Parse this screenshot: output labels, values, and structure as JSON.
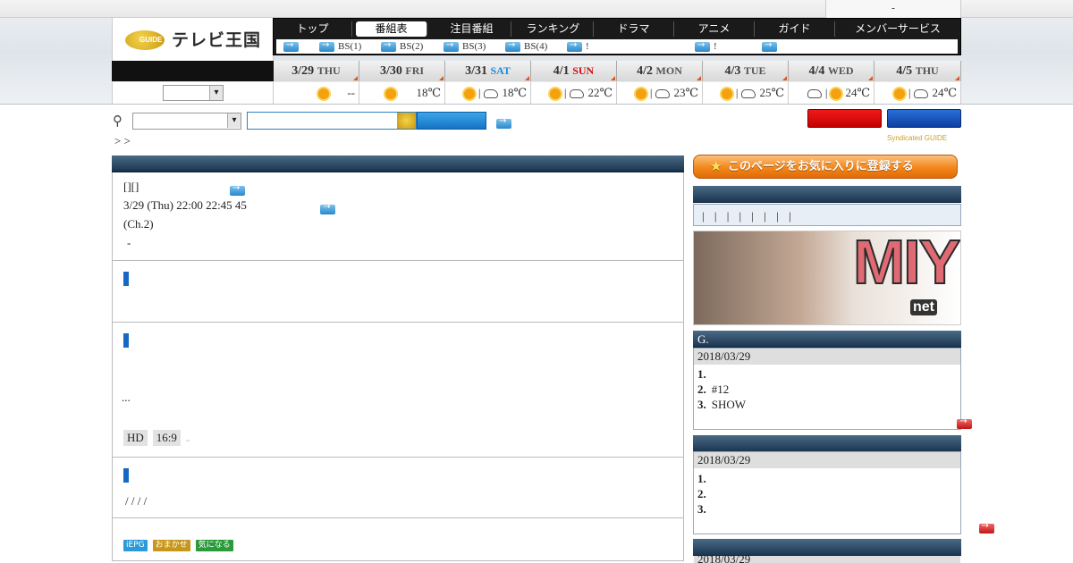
{
  "utility": {
    "text": "-"
  },
  "logo": {
    "badge": "GUIDE",
    "title": "テレビ王国"
  },
  "nav": {
    "items": [
      "トップ",
      "番組表",
      "注目番組",
      "ランキング",
      "ドラマ",
      "アニメ",
      "ガイド",
      "メンバーサービス"
    ],
    "active_index": 1
  },
  "subnav": {
    "items": [
      "",
      "BS(1)",
      "BS(2)",
      "BS(3)",
      "BS(4)",
      "!",
      "!",
      ""
    ]
  },
  "weather": {
    "days": [
      {
        "date": "3/29",
        "dow": "THU",
        "kind": "weekday",
        "forecast": "--"
      },
      {
        "date": "3/30",
        "dow": "FRI",
        "kind": "weekday",
        "forecast": "18℃"
      },
      {
        "date": "3/31",
        "dow": "SAT",
        "kind": "sat",
        "forecast": "18℃"
      },
      {
        "date": "4/1",
        "dow": "SUN",
        "kind": "sun",
        "forecast": "22℃"
      },
      {
        "date": "4/2",
        "dow": "MON",
        "kind": "weekday",
        "forecast": "23℃"
      },
      {
        "date": "4/3",
        "dow": "TUE",
        "kind": "weekday",
        "forecast": "25℃"
      },
      {
        "date": "4/4",
        "dow": "WED",
        "kind": "weekday",
        "forecast": "24℃"
      },
      {
        "date": "4/5",
        "dow": "THU",
        "kind": "weekday",
        "forecast": "24℃"
      }
    ],
    "separator": "|",
    "region_select": {
      "value": ""
    }
  },
  "search": {
    "category_value": "",
    "query": ""
  },
  "breadcrumb": "> >",
  "syndicated": "Syndicated GUIDE",
  "program": {
    "line1": "[][]",
    "line2": "3/29 (Thu) 22:00  22:45 45",
    "line3": "(Ch.2)",
    "line4": "-",
    "ellipsis": "...",
    "tags": [
      "HD",
      "16:9",
      ""
    ],
    "slashes": "/ / / /",
    "badges": [
      "iEPG",
      "おまかせ",
      "気になる"
    ]
  },
  "sidebar": {
    "fav_label": "このページをお気に入りに登録する",
    "bars_text": "| | | | | | | |",
    "banner_text": "MIYU",
    "banner_logo": "net",
    "ranking1": {
      "title": "G.",
      "date": "2018/03/29",
      "items": [
        {
          "n": "1.",
          "t": ""
        },
        {
          "n": "2.",
          "t": "#12"
        },
        {
          "n": "3.",
          "t": "SHOW"
        }
      ]
    },
    "ranking2": {
      "title": "",
      "date": "2018/03/29",
      "items": [
        {
          "n": "1.",
          "t": ""
        },
        {
          "n": "2.",
          "t": ""
        },
        {
          "n": "3.",
          "t": ""
        }
      ]
    },
    "ranking3": {
      "title": "",
      "date": "2018/03/29"
    }
  },
  "colors": {
    "accent_blue": "#1668c4",
    "header_navy": "#1c3650",
    "sat": "#1e8bd6",
    "sun": "#d01010",
    "fav_orange": "#f2871c"
  }
}
